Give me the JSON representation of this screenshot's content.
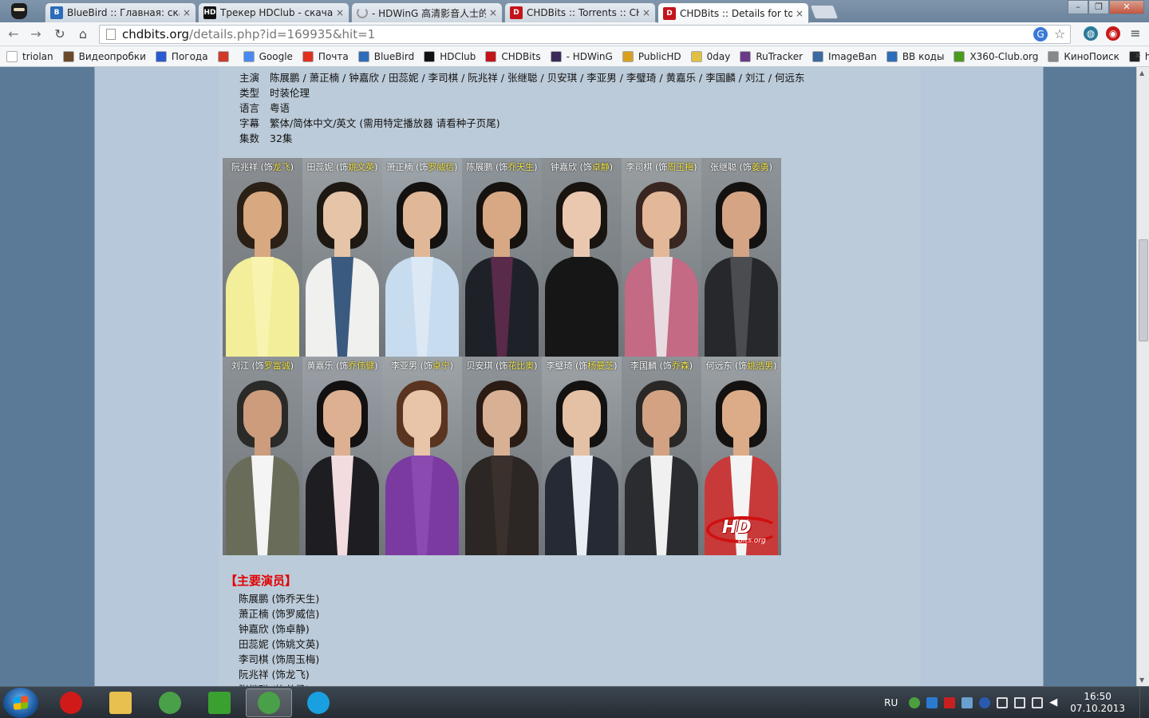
{
  "browser": {
    "tabs": [
      {
        "title": "BlueBird :: Главная: скача",
        "favicon": "bluebird-icon",
        "active": false
      },
      {
        "title": "Трекер HDClub - скачать",
        "favicon": "hdclub-icon",
        "active": false
      },
      {
        "title": "- HDWinG 高清影音人士的",
        "favicon": "loading-icon",
        "active": false
      },
      {
        "title": "CHDBits :: Torrents :: CHD",
        "favicon": "chd-icon",
        "active": false
      },
      {
        "title": "CHDBits :: Details for torre",
        "favicon": "chd-icon",
        "active": true
      }
    ],
    "tab_close": "×",
    "url_host": "chdbits.org",
    "url_path": "/details.php?id=169935&hit=1",
    "bookmarks": [
      {
        "label": "triolan",
        "color": "#ffffff"
      },
      {
        "label": "Видеопробки",
        "color": "#6a4a2a"
      },
      {
        "label": "Погода",
        "color": "#2a5ad0"
      },
      {
        "label": "",
        "color": "#d03a2a"
      },
      {
        "label": "Google",
        "color": "#4a8af0"
      },
      {
        "label": "Почта",
        "color": "#e03020"
      },
      {
        "label": "BlueBird",
        "color": "#2d6cb8"
      },
      {
        "label": "HDClub",
        "color": "#111111"
      },
      {
        "label": "CHDBits",
        "color": "#c4141b"
      },
      {
        "label": "- HDWinG",
        "color": "#3a2a5a"
      },
      {
        "label": "PublicHD",
        "color": "#d8a020"
      },
      {
        "label": "0day",
        "color": "#e0c040"
      },
      {
        "label": "RuTracker",
        "color": "#6a3a8a"
      },
      {
        "label": "ImageBan",
        "color": "#3a6aa0"
      },
      {
        "label": "BB коды",
        "color": "#2d6cb8"
      },
      {
        "label": "X360-Club.org",
        "color": "#4a9a20"
      },
      {
        "label": "КиноПоиск",
        "color": "#888888"
      },
      {
        "label": "hotline.ua",
        "color": "#222222"
      }
    ],
    "bookmarks_more": "»"
  },
  "info": {
    "cast_label": "主演",
    "cast_value": "陈展鹏 / 萧正楠 / 钟嘉欣 / 田蕊妮 / 李司棋 / 阮兆祥 / 张继聪 / 贝安琪 / 李亚男 / 李璧琦 / 黄嘉乐 / 李国麟 / 刘江 / 何远东",
    "genre_label": "类型",
    "genre_value": "时装伦理",
    "language_label": "语言",
    "language_value": "粤语",
    "subtitle_label": "字幕",
    "subtitle_value": "繁体/简体中文/英文 (需用特定播放器 请看种子页尾)",
    "episodes_label": "集数",
    "episodes_value": "32集"
  },
  "cast_grid": [
    {
      "actor": "阮兆祥",
      "pre": " (饰",
      "role": "龙飞",
      "post": ")",
      "bg": "#8a8e92",
      "skin": "#d8a880",
      "hair": "#2a2016",
      "top": "#f2ee9a",
      "shirt": "#f8f4b0"
    },
    {
      "actor": "田蕊妮",
      "pre": " (饰",
      "role": "姚文英",
      "post": ")",
      "bg": "#9aa0a4",
      "skin": "#e6c4a8",
      "hair": "#1e1812",
      "top": "#f0f0ee",
      "shirt": "#3a5a80"
    },
    {
      "actor": "萧正楠",
      "pre": " (饰",
      "role": "罗威信",
      "post": ")",
      "bg": "#9ea6ac",
      "skin": "#e0b898",
      "hair": "#141210",
      "top": "#c8dcf0",
      "shirt": "#dce8f4"
    },
    {
      "actor": "陈展鹏",
      "pre": " (饰",
      "role": "乔天生",
      "post": ")",
      "bg": "#8e969c",
      "skin": "#d8a884",
      "hair": "#16120e",
      "top": "#1e2228",
      "shirt": "#5a2a4a"
    },
    {
      "actor": "钟嘉欣",
      "pre": " (饰",
      "role": "卓静",
      "post": ")",
      "bg": "#8a9094",
      "skin": "#eac8b0",
      "hair": "#1a1410",
      "top": "#161616",
      "shirt": "#161616"
    },
    {
      "actor": "李司棋",
      "pre": " (饰",
      "role": "周玉梅",
      "post": ")",
      "bg": "#9aa0a2",
      "skin": "#e2b898",
      "hair": "#3a2620",
      "top": "#c46a84",
      "shirt": "#e8dce0"
    },
    {
      "actor": "张继聪",
      "pre": " (饰",
      "role": "姜勇",
      "post": ")",
      "bg": "#8e9498",
      "skin": "#d4a484",
      "hair": "#141210",
      "top": "#26282c",
      "shirt": "#4a4c50"
    },
    {
      "actor": "刘江",
      "pre": " (饰",
      "role": "罗富诚",
      "post": ")",
      "bg": "#8c9296",
      "skin": "#cc9c7c",
      "hair": "#2a2a28",
      "top": "#6a6c5a",
      "shirt": "#f4f4f4"
    },
    {
      "actor": "黄嘉乐",
      "pre": " (饰",
      "role": "乔伟健",
      "post": ")",
      "bg": "#9aa0a6",
      "skin": "#dcb090",
      "hair": "#121010",
      "top": "#1e1e22",
      "shirt": "#f2dce0"
    },
    {
      "actor": "李亚男",
      "pre": " (饰",
      "role": "卓宁",
      "post": ")",
      "bg": "#9ea4a8",
      "skin": "#e8c4a8",
      "hair": "#5a3420",
      "top": "#7a3aa0",
      "shirt": "#8a4ab0"
    },
    {
      "actor": "贝安琪",
      "pre": " (饰",
      "role": "花比奥",
      "post": ")",
      "bg": "#8e9498",
      "skin": "#d8b094",
      "hair": "#2a1c14",
      "top": "#2c2624",
      "shirt": "#3a302c"
    },
    {
      "actor": "李璧琦",
      "pre": " (饰",
      "role": "杨曼芝",
      "post": ")",
      "bg": "#9ca2a6",
      "skin": "#e4c0a4",
      "hair": "#141210",
      "top": "#262a34",
      "shirt": "#e8eef4"
    },
    {
      "actor": "李国麟",
      "pre": " (饰",
      "role": "乔森",
      "post": ")",
      "bg": "#8c9296",
      "skin": "#d2a282",
      "hair": "#2a2826",
      "top": "#2a2c30",
      "shirt": "#f0f0f0"
    },
    {
      "actor": "何远东",
      "pre": " (饰",
      "role": "姚浩男",
      "post": ")",
      "bg": "#9aa0a4",
      "skin": "#dcac88",
      "hair": "#141210",
      "top": "#c83a3a",
      "shirt": "#f4f4f4"
    }
  ],
  "logo": {
    "text": "HD",
    "sub": "Bits.org"
  },
  "main_cast": {
    "title": "【主要演员】",
    "lines": [
      "陈展鹏 (饰乔天生)",
      "萧正楠 (饰罗威信)",
      "钟嘉欣 (饰卓静)",
      "田蕊妮 (饰姚文英)",
      "李司棋 (饰周玉梅)",
      "阮兆祥 (饰龙飞)",
      "张继聪 (饰姜勇)"
    ]
  },
  "taskbar": {
    "apps": [
      {
        "name": "opera",
        "color": "#d01a1a",
        "active": false
      },
      {
        "name": "explorer",
        "color": "#e8c050",
        "active": false
      },
      {
        "name": "chrome",
        "color": "#4aa048",
        "active": false
      },
      {
        "name": "utorrent",
        "color": "#3aa030",
        "active": false
      },
      {
        "name": "chrome-active",
        "color": "#4aa048",
        "active": true
      },
      {
        "name": "skype",
        "color": "#18a0e0",
        "active": false
      }
    ],
    "lang": "RU",
    "time": "16:50",
    "date": "07.10.2013"
  }
}
